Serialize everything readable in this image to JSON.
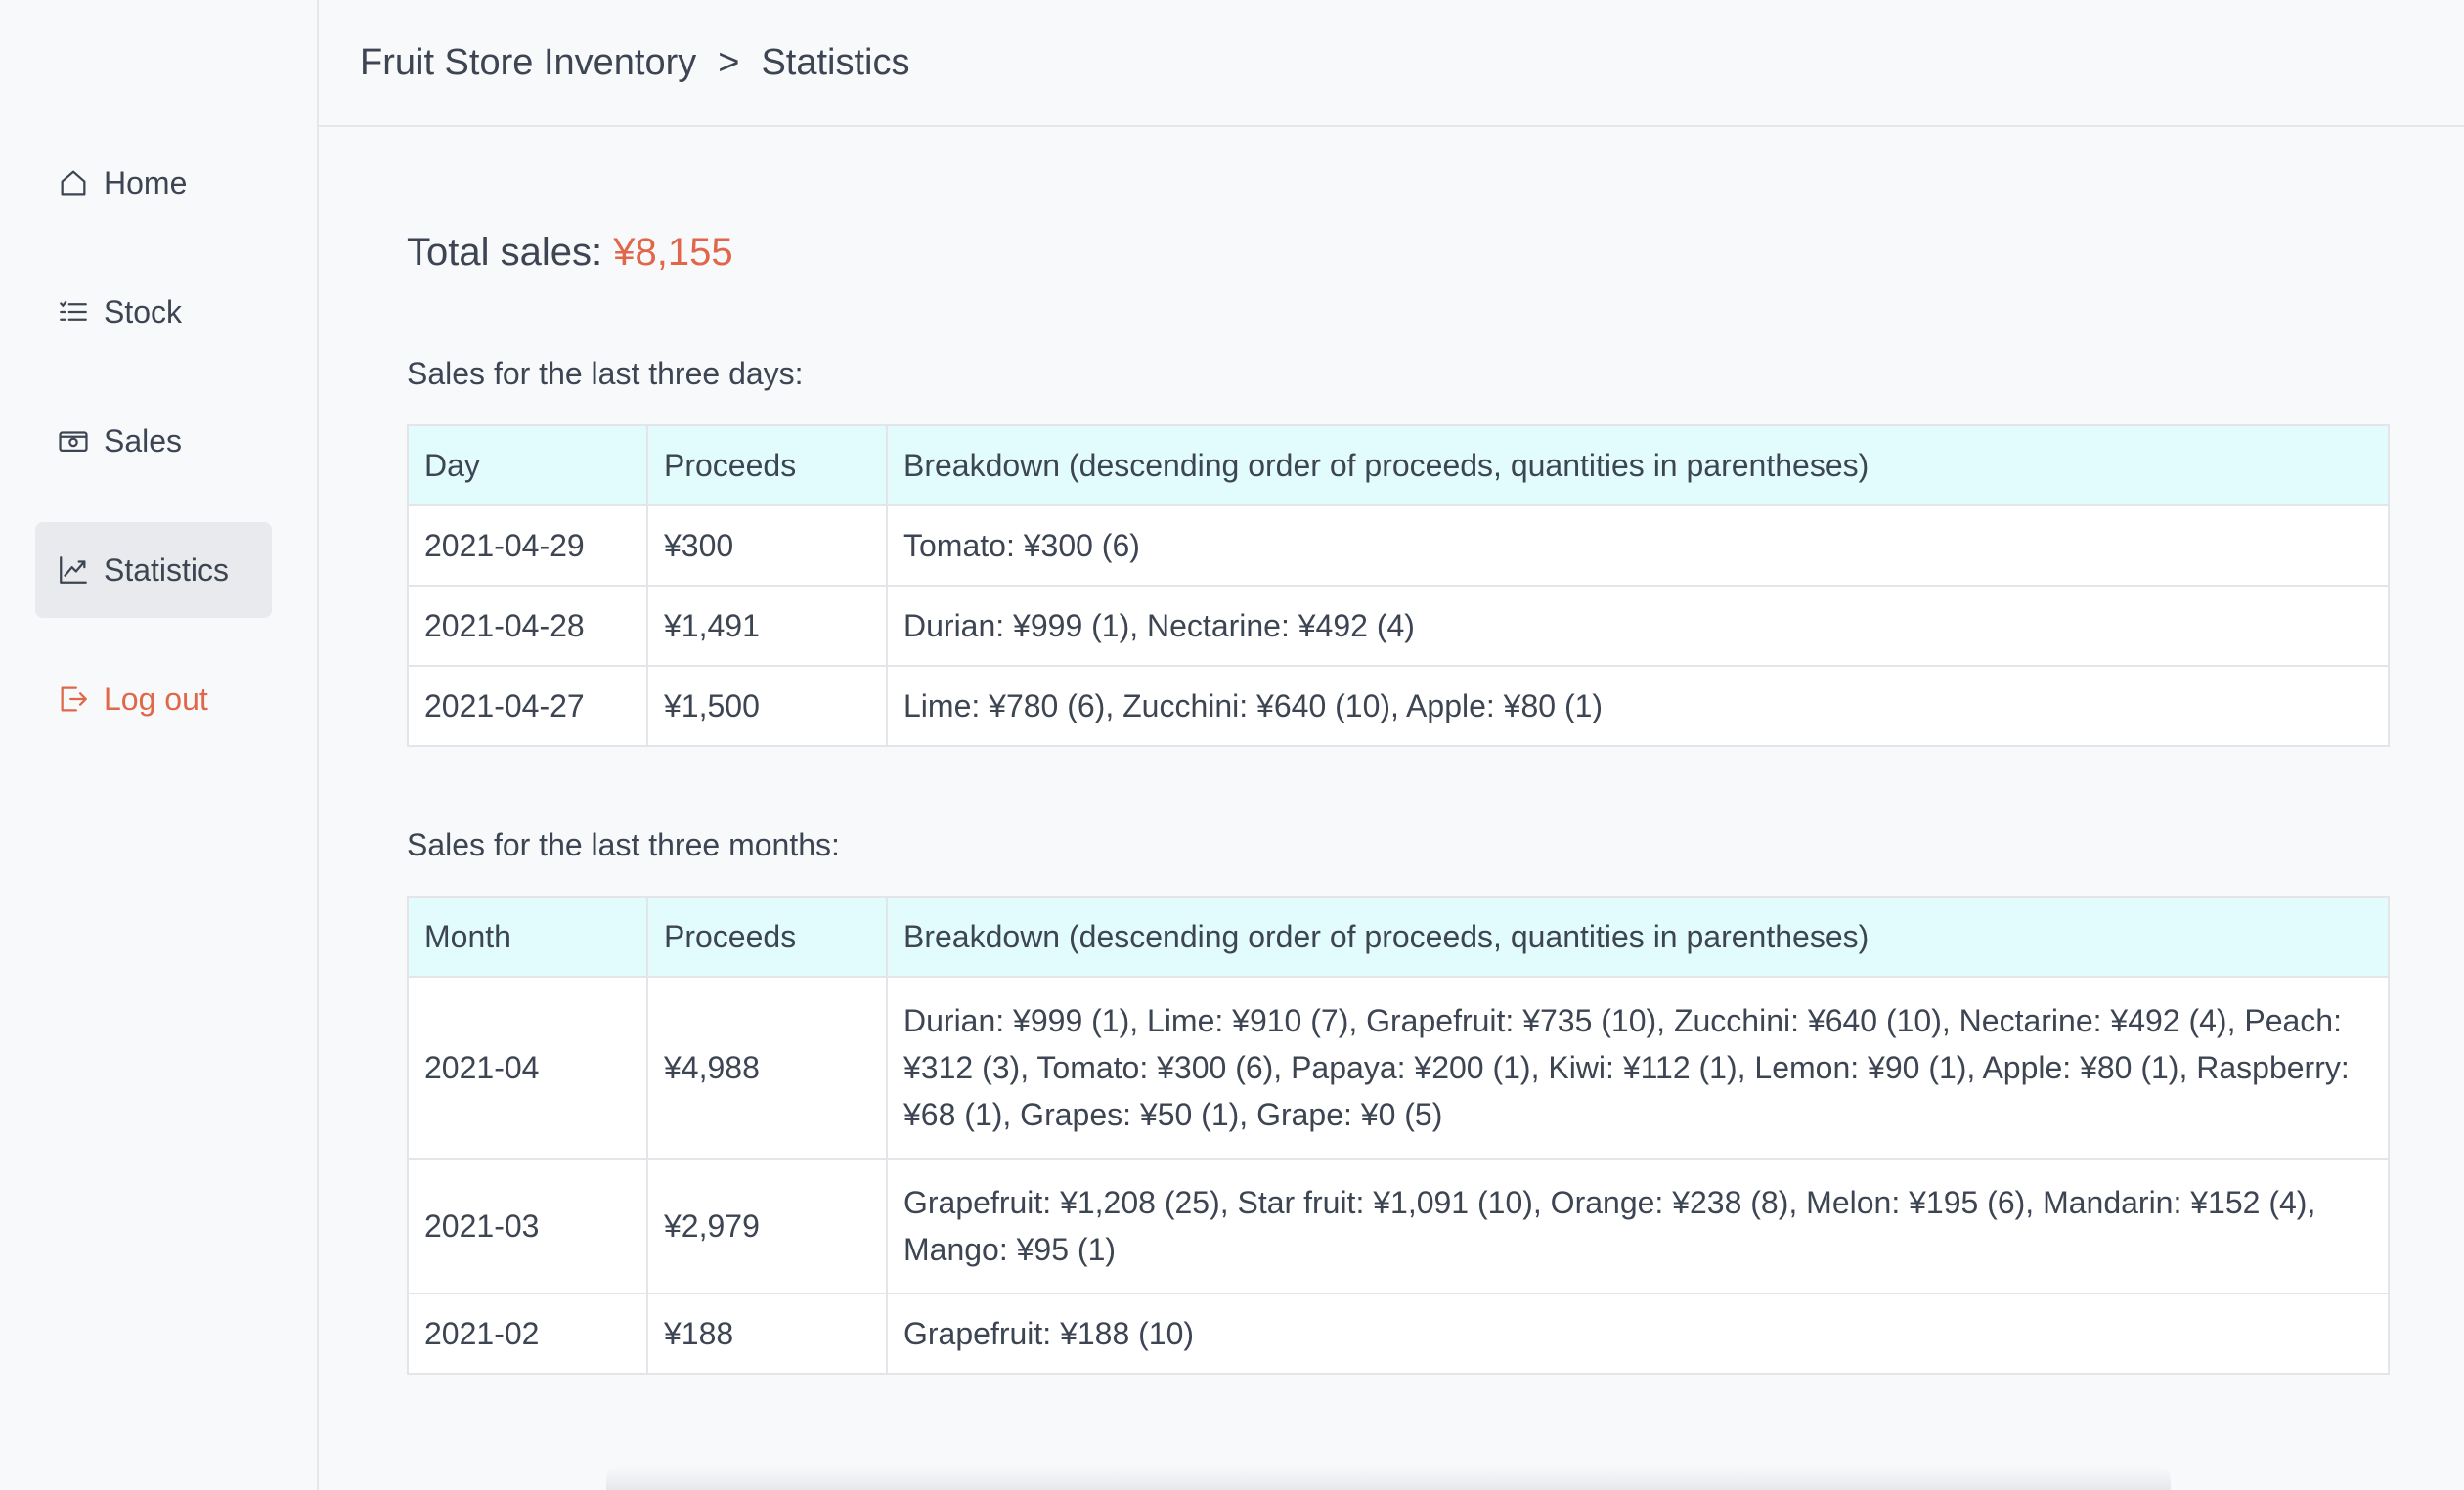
{
  "breadcrumb": {
    "root": "Fruit Store Inventory",
    "separator": ">",
    "current": "Statistics"
  },
  "sidebar": {
    "items": [
      {
        "label": "Home",
        "icon": "home-icon"
      },
      {
        "label": "Stock",
        "icon": "list-icon"
      },
      {
        "label": "Sales",
        "icon": "cash-icon"
      },
      {
        "label": "Statistics",
        "icon": "chart-icon",
        "active": true
      },
      {
        "label": "Log out",
        "icon": "logout-icon"
      }
    ]
  },
  "colors": {
    "accent": "#e0674a",
    "table_header_bg": "#e2fcfd",
    "active_nav_bg": "#e8eaed"
  },
  "summary": {
    "total_label": "Total sales:",
    "total_value": "¥8,155"
  },
  "days_section": {
    "label": "Sales for the last three days:",
    "headers": [
      "Day",
      "Proceeds",
      "Breakdown (descending order of proceeds, quantities in parentheses)"
    ],
    "rows": [
      {
        "period": "2021-04-29",
        "proceeds": "¥300",
        "breakdown": "Tomato: ¥300 (6)"
      },
      {
        "period": "2021-04-28",
        "proceeds": "¥1,491",
        "breakdown": "Durian: ¥999 (1), Nectarine: ¥492 (4)"
      },
      {
        "period": "2021-04-27",
        "proceeds": "¥1,500",
        "breakdown": "Lime: ¥780 (6), Zucchini: ¥640 (10), Apple: ¥80 (1)"
      }
    ]
  },
  "months_section": {
    "label": "Sales for the last three months:",
    "headers": [
      "Month",
      "Proceeds",
      "Breakdown (descending order of proceeds, quantities in parentheses)"
    ],
    "rows": [
      {
        "period": "2021-04",
        "proceeds": "¥4,988",
        "breakdown": "Durian: ¥999 (1), Lime: ¥910 (7), Grapefruit: ¥735 (10), Zucchini: ¥640 (10), Nectarine: ¥492 (4), Peach: ¥312 (3), Tomato: ¥300 (6), Papaya: ¥200 (1), Kiwi: ¥112 (1), Lemon: ¥90 (1), Apple: ¥80 (1), Raspberry: ¥68 (1), Grapes: ¥50 (1), Grape: ¥0 (5)"
      },
      {
        "period": "2021-03",
        "proceeds": "¥2,979",
        "breakdown": "Grapefruit: ¥1,208 (25), Star fruit: ¥1,091 (10), Orange: ¥238 (8), Melon: ¥195 (6), Mandarin: ¥152 (4), Mango: ¥95 (1)"
      },
      {
        "period": "2021-02",
        "proceeds": "¥188",
        "breakdown": "Grapefruit: ¥188 (10)"
      }
    ]
  }
}
